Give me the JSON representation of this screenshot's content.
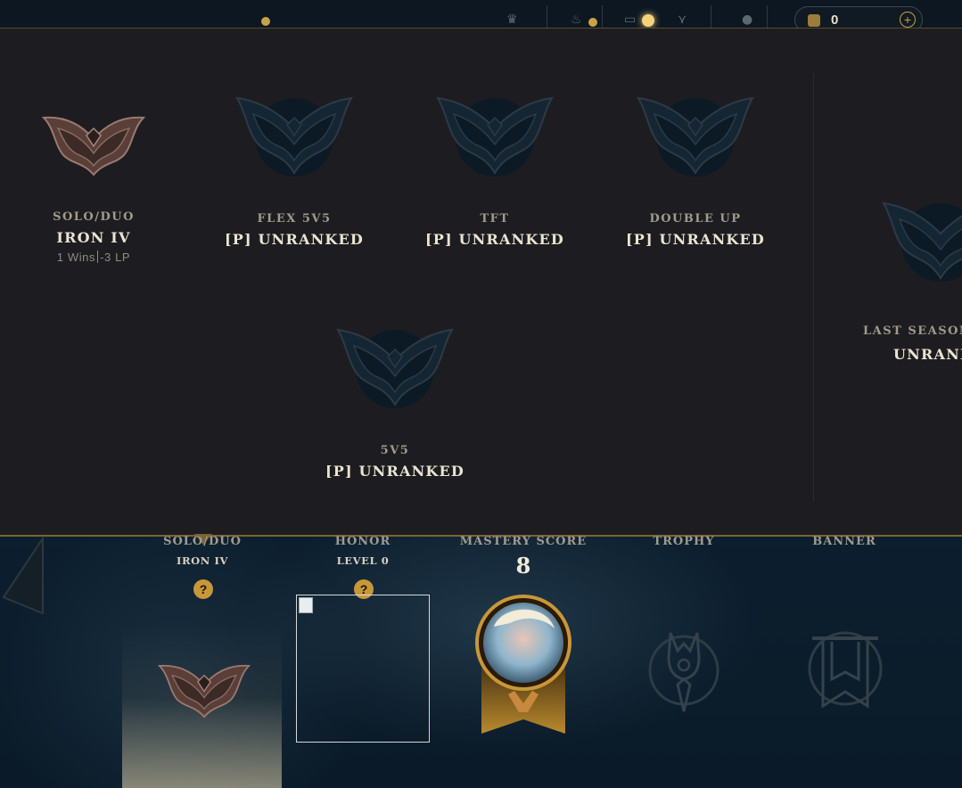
{
  "top_bar": {
    "currency_amount": "0",
    "add_currency_symbol": "+"
  },
  "ranked_queues": [
    {
      "name": "SOLO/DUO",
      "rank": "IRON IV",
      "wins": "1 Wins",
      "lp": "-3 LP",
      "emblem": "iron-emblem"
    },
    {
      "name": "FLEX 5V5",
      "rank": "[P] UNRANKED",
      "emblem": "unranked-emblem"
    },
    {
      "name": "TFT",
      "rank": "[P] UNRANKED",
      "emblem": "unranked-emblem"
    },
    {
      "name": "DOUBLE UP",
      "rank": "[P] UNRANKED",
      "emblem": "unranked-emblem"
    },
    {
      "name": "5V5",
      "rank": "[P] UNRANKED",
      "emblem": "unranked-emblem"
    }
  ],
  "last_season": {
    "label": "LAST SEASON",
    "rank": "UNRANK"
  },
  "profile_strip": {
    "solo": {
      "label": "SOLO/DUO",
      "sub": "IRON IV"
    },
    "honor": {
      "label": "HONOR",
      "sub": "LEVEL 0"
    },
    "mastery": {
      "label": "MASTERY SCORE",
      "score": "8"
    },
    "trophy": {
      "label": "TROPHY"
    },
    "banner": {
      "label": "BANNER"
    },
    "help_symbol": "?"
  },
  "colors": {
    "panel_bg": "#1d1d21",
    "gold_accent": "#c8973a",
    "text_light": "#eae4d2",
    "text_muted": "#a09b8c"
  }
}
